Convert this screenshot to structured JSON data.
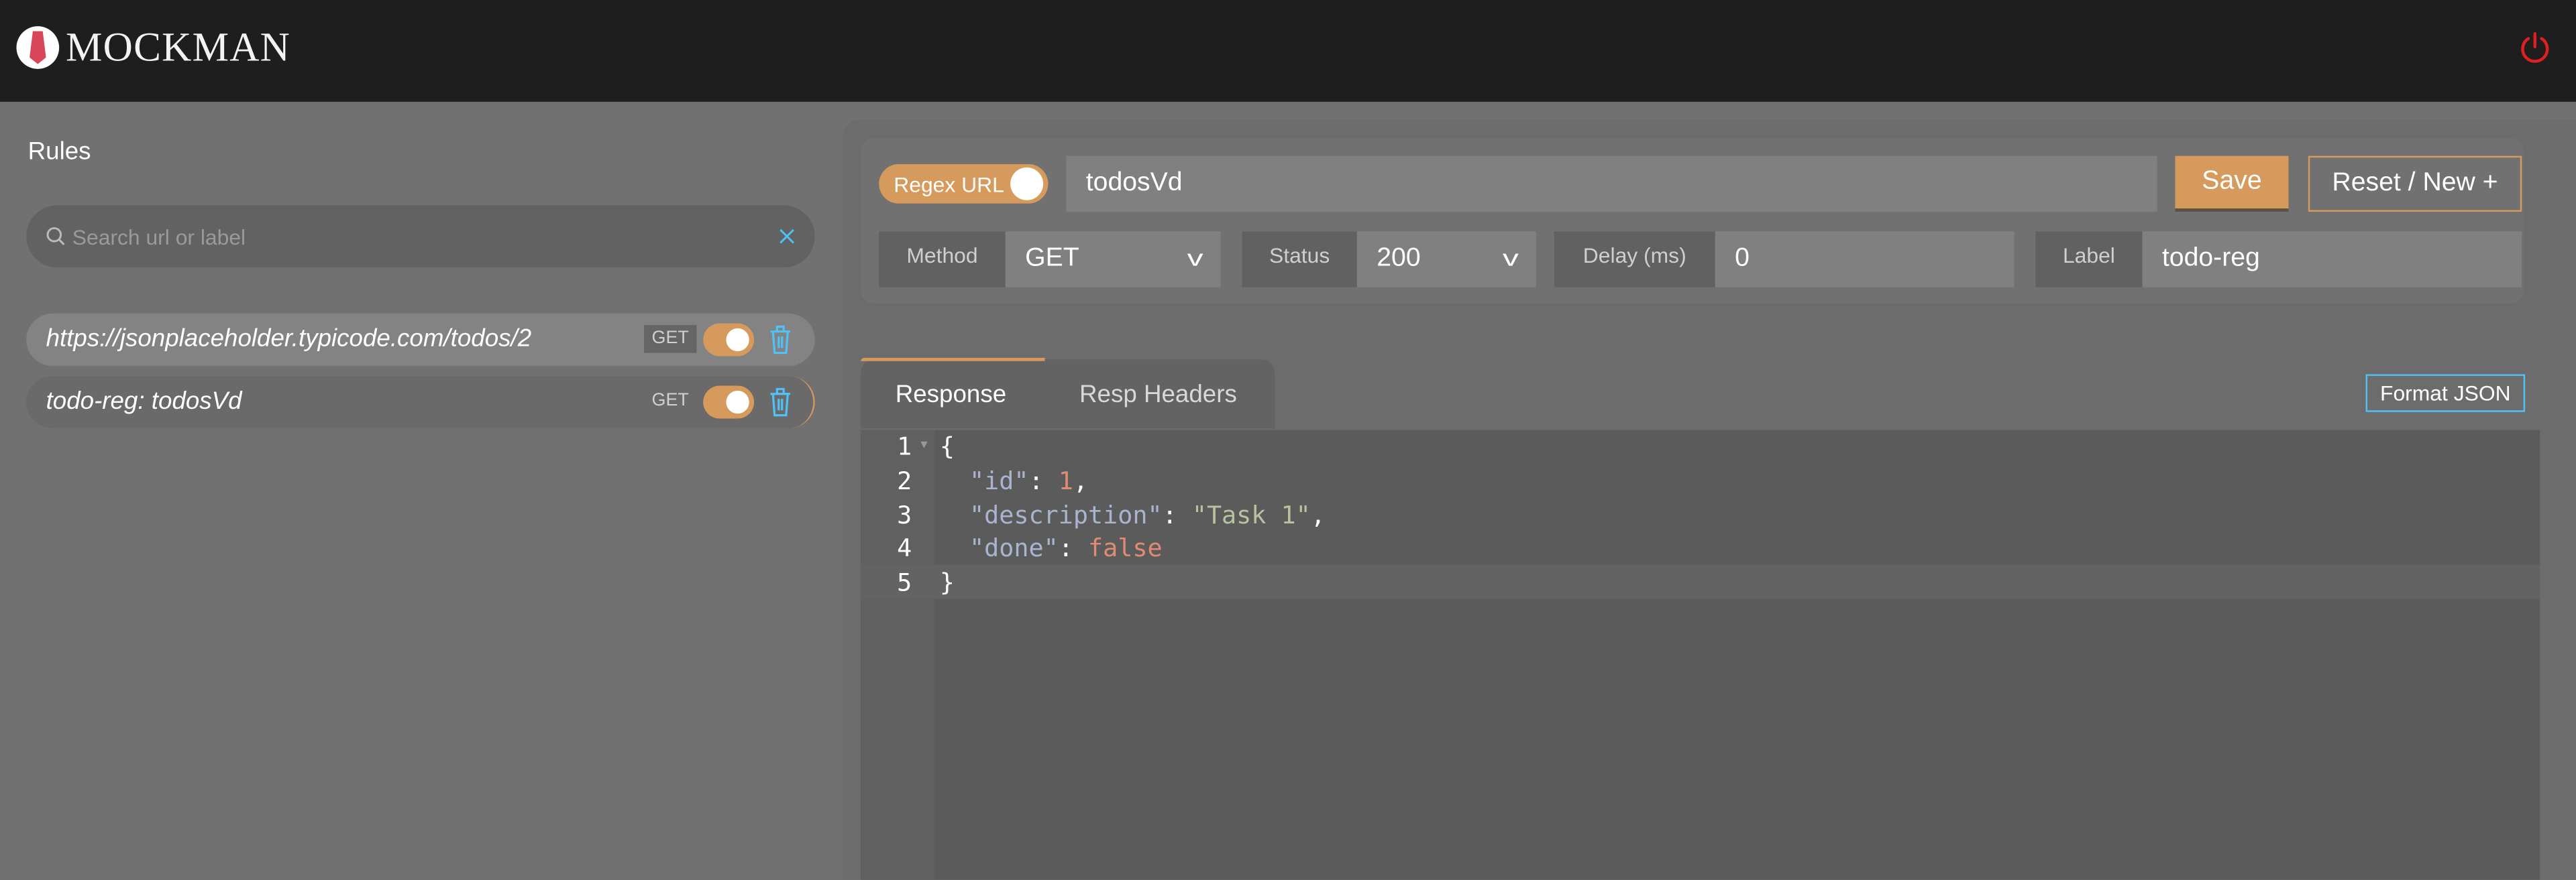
{
  "app": {
    "name": "MOCKMAN"
  },
  "colors": {
    "accent": "#d59a5c",
    "header": "#1e1e1e",
    "power": "#e02020",
    "trash": "#4fc3f7"
  },
  "sidebar": {
    "title": "Rules",
    "search_placeholder": "Search url or label",
    "clear_icon": "close-icon",
    "rules": [
      {
        "text": "https://jsonplaceholder.typicode.com/todos/2",
        "method": "GET",
        "enabled": true
      },
      {
        "text": "todo-reg: todosVd",
        "method": "GET",
        "enabled": true
      }
    ]
  },
  "editor": {
    "regex_label": "Regex URL",
    "regex_enabled": true,
    "url": "todosVd",
    "save": "Save",
    "reset": "Reset / New +",
    "method_label": "Method",
    "method": "GET",
    "status_label": "Status",
    "status": "200",
    "delay_label": "Delay (ms)",
    "delay": "0",
    "label_label": "Label",
    "label": "todo-reg",
    "tabs": [
      "Response",
      "Resp Headers"
    ],
    "format_json": "Format JSON",
    "lines": [
      "1",
      "2",
      "3",
      "4",
      "5"
    ],
    "code": {
      "open": "{",
      "k1": "\"id\"",
      "v1": "1",
      "k2": "\"description\"",
      "v2": "\"Task 1\"",
      "k3": "\"done\"",
      "v3": "false",
      "close": "}"
    }
  }
}
